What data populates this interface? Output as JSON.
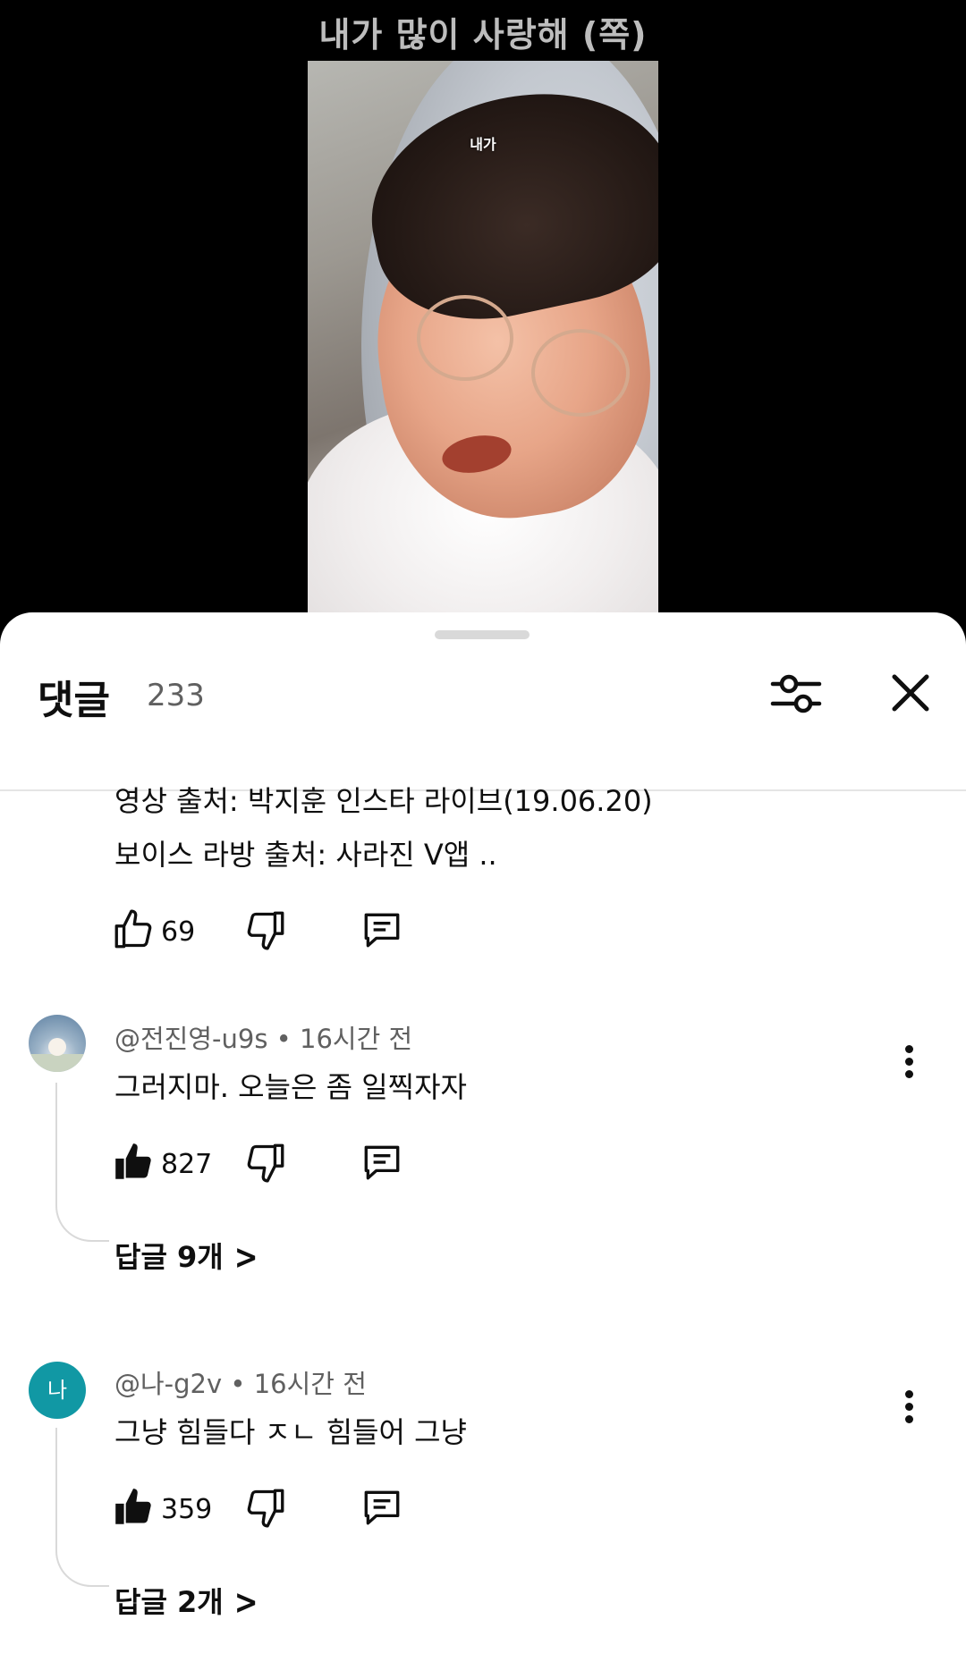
{
  "video": {
    "caption": "내가 많이 사랑해 (쪽)",
    "overlay_subtitle": "내가"
  },
  "sheet": {
    "title": "댓글",
    "count": "233",
    "filter_icon": "sliders-icon",
    "close_icon": "close-icon"
  },
  "comments": [
    {
      "text_lines": [
        "영상 출처: 박지훈 인스타 라이브(19.06.20)",
        "보이스 라방 출처: 사라진 V앱 .."
      ],
      "likes": "69",
      "liked": false
    },
    {
      "author": "@전진영-u9s",
      "separator": "•",
      "time": "16시간 전",
      "text": "그러지마. 오늘은 좀 일찍자자",
      "likes": "827",
      "liked": true,
      "replies": "답글 9개"
    },
    {
      "author": "@나-g2v",
      "avatar_letter": "나",
      "avatar_color": "#1198a4",
      "separator": "•",
      "time": "16시간 전",
      "text": "그냥 힘들다 ㅈㄴ 힘들어 그냥",
      "likes": "359",
      "liked": true,
      "replies": "답글 2개"
    }
  ],
  "icons": {
    "like": "thumbs-up-icon",
    "dislike": "thumbs-down-icon",
    "reply": "reply-comment-icon",
    "more": "more-vert-icon",
    "chevron": "chevron-right-icon"
  }
}
